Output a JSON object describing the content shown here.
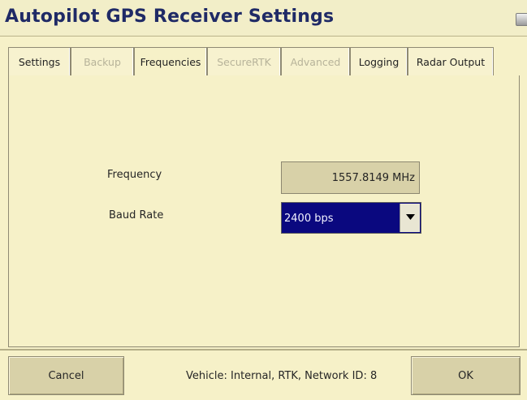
{
  "window": {
    "title": "Autopilot GPS Receiver Settings",
    "icon": "window-restore-icon"
  },
  "tabs": [
    {
      "label": "Settings",
      "enabled": true
    },
    {
      "label": "Backup",
      "enabled": false
    },
    {
      "label": "Frequencies",
      "enabled": true,
      "selected": true
    },
    {
      "label": "SecureRTK",
      "enabled": false
    },
    {
      "label": "Advanced",
      "enabled": false
    },
    {
      "label": "Logging",
      "enabled": true
    },
    {
      "label": "Radar Output",
      "enabled": true
    }
  ],
  "form": {
    "frequency_label": "Frequency",
    "frequency_value": "1557.8149 MHz",
    "baud_label": "Baud Rate",
    "baud_value": "2400 bps"
  },
  "footer": {
    "cancel_label": "Cancel",
    "status_text": "Vehicle: Internal, RTK, Network ID: 8",
    "ok_label": "OK"
  },
  "colors": {
    "background": "#f6f1c8",
    "title_text": "#1f2a66",
    "dropdown_selected": "#0a087f",
    "disabled_text": "#b7b39a"
  }
}
